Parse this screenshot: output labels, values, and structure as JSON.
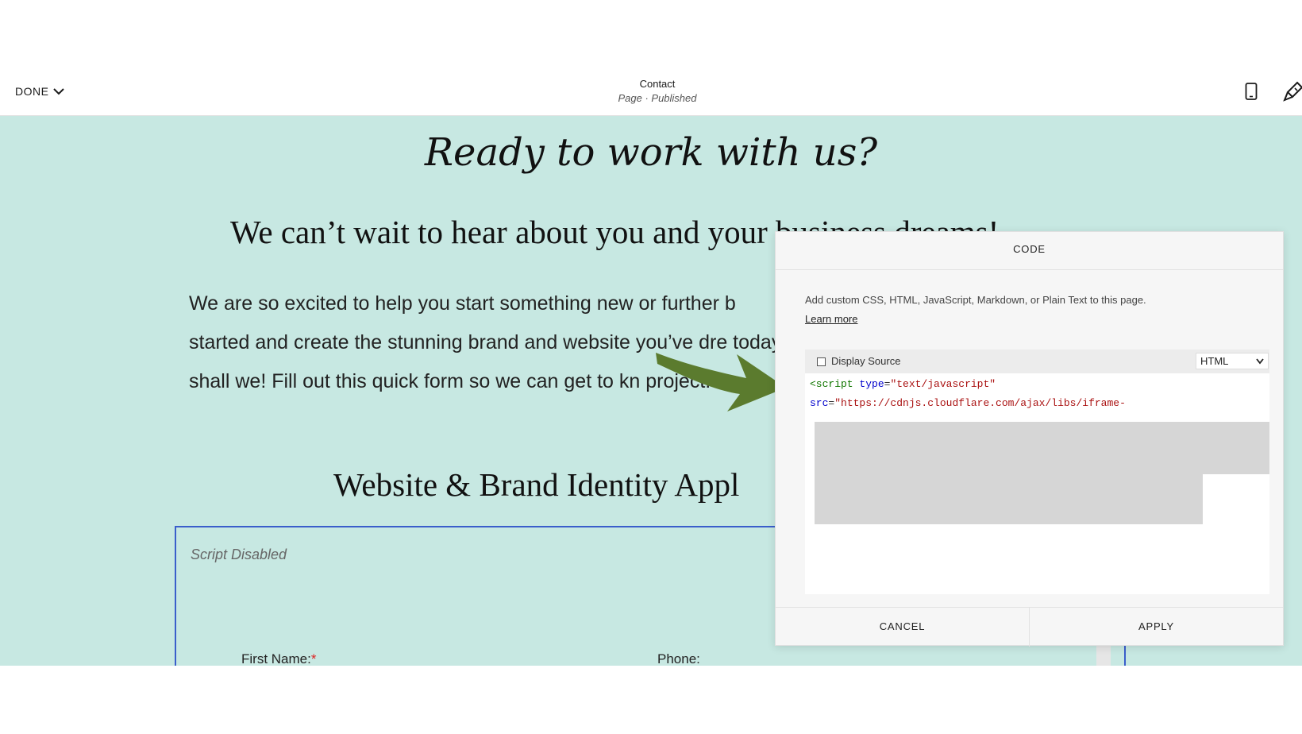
{
  "topbar": {
    "done_label": "DONE",
    "page_title": "Contact",
    "page_status": "Page · Published",
    "icons": [
      "chevron-down-icon",
      "mobile-icon",
      "paintbrush-icon"
    ]
  },
  "content": {
    "heading": "Ready to work with us?",
    "subheading": "We can’t wait to hear about you and your business dreams!",
    "paragraph": "We are so excited to help you start something new or further b started and create the stunning brand and website you’ve dre today, shall we! Fill out this quick form so we can get to kn project.",
    "form_heading": "Website & Brand Identity Appl",
    "script_disabled": "Script Disabled",
    "first_name_label": "First Name:",
    "required_mark": "*",
    "phone_label": "Phone:"
  },
  "dialog": {
    "title": "CODE",
    "description": "Add custom CSS, HTML, JavaScript, Markdown, or Plain Text to this page.",
    "learn_more": "Learn more",
    "display_source_label": "Display Source",
    "language_selected": "HTML",
    "code": {
      "line1_tag": "<script",
      "line1_attr": "type",
      "line1_eq": "=",
      "line1_str": "\"text/javascript\"",
      "line2_attr": "src",
      "line2_eq": "=",
      "line2_str": "\"https://cdnjs.cloudflare.com/ajax/libs/iframe-"
    },
    "cancel_label": "CANCEL",
    "apply_label": "APPLY"
  },
  "colors": {
    "canvas_bg": "#c7e8e2",
    "form_border": "#3a5ecb",
    "arrow": "#5b7b2e"
  }
}
